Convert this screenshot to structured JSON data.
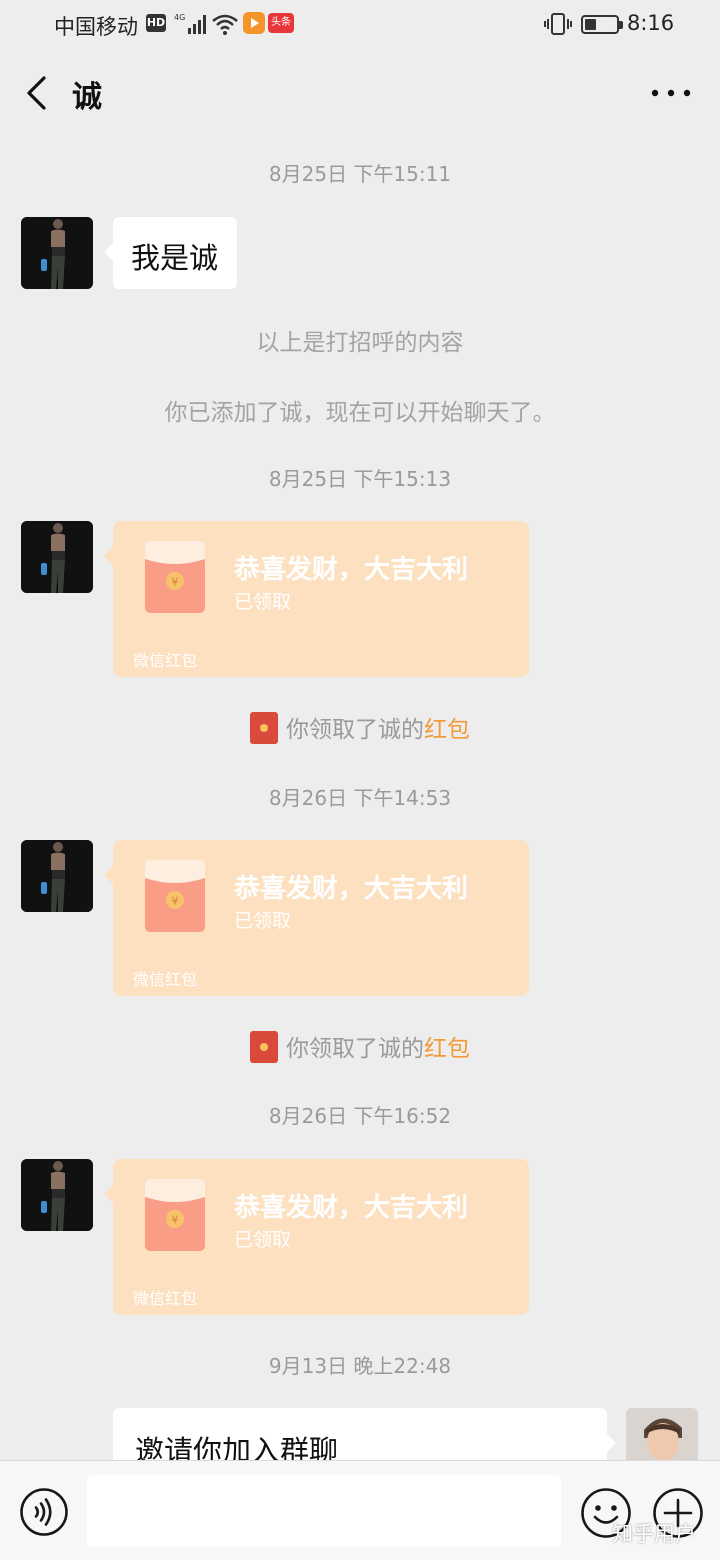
{
  "status_bar": {
    "carrier": "中国移动",
    "hd_badge": "HD",
    "network": "4G",
    "app_badge": "头条",
    "time": "8:16",
    "battery_level": 0.35
  },
  "header": {
    "title": "诚",
    "back_icon": "chevron-left-icon",
    "more_icon": "more-dots-icon"
  },
  "messages": {
    "ts1": "8月25日 下午15:11",
    "greeting_text": "我是诚",
    "sys1": "以上是打招呼的内容",
    "sys2": "你已添加了诚，现在可以开始聊天了。",
    "ts2": "8月25日 下午15:13",
    "ts3": "8月26日 下午14:53",
    "ts4": "8月26日 下午16:52",
    "ts5": "9月13日 晚上22:48",
    "invite_text": "邀请你加入群聊"
  },
  "red_packet": {
    "title": "恭喜发财，大吉大利",
    "status": "已领取",
    "footer": "微信红包",
    "currency_symbol": "¥"
  },
  "claim_notice": {
    "prefix": "你领取了诚的",
    "link": "红包"
  },
  "input_bar": {
    "voice_icon": "voice-icon",
    "emoji_icon": "emoji-icon",
    "plus_icon": "plus-icon"
  },
  "watermark": "知乎用户",
  "colors": {
    "background": "#ededed",
    "red_packet_bg": "#fce0c0",
    "envelope_red": "#fa9d87",
    "link_orange": "#f29a38"
  }
}
